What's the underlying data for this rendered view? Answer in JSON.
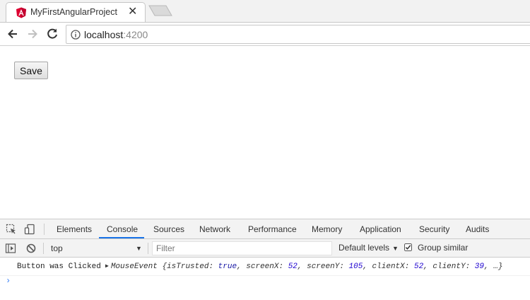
{
  "browser": {
    "tab": {
      "title": "MyFirstAngularProject",
      "close_glyph": "✕",
      "favicon": "angular-icon"
    },
    "toolbar": {
      "url_host": "localhost",
      "url_port": ":4200"
    }
  },
  "page": {
    "save_label": "Save"
  },
  "devtools": {
    "tabs": [
      {
        "label": "Elements"
      },
      {
        "label": "Console",
        "active": true
      },
      {
        "label": "Sources"
      },
      {
        "label": "Network"
      },
      {
        "label": "Performance"
      },
      {
        "label": "Memory"
      },
      {
        "label": "Application"
      },
      {
        "label": "Security"
      },
      {
        "label": "Audits"
      }
    ],
    "context": "top",
    "filter_placeholder": "Filter",
    "levels_label": "Default levels",
    "group_similar_label": "Group similar",
    "group_similar_checked": true,
    "log": {
      "message": "Button was Clicked",
      "object_name": "MouseEvent",
      "props": [
        {
          "key": "isTrusted",
          "value": "true"
        },
        {
          "key": "screenX",
          "value": "52"
        },
        {
          "key": "screenY",
          "value": "105"
        },
        {
          "key": "clientX",
          "value": "52"
        },
        {
          "key": "clientY",
          "value": "39"
        }
      ],
      "ellipsis": "…"
    },
    "prompt_glyph": "›"
  },
  "colors": {
    "accent": "#1a73e8",
    "angular_red": "#dd0031"
  }
}
